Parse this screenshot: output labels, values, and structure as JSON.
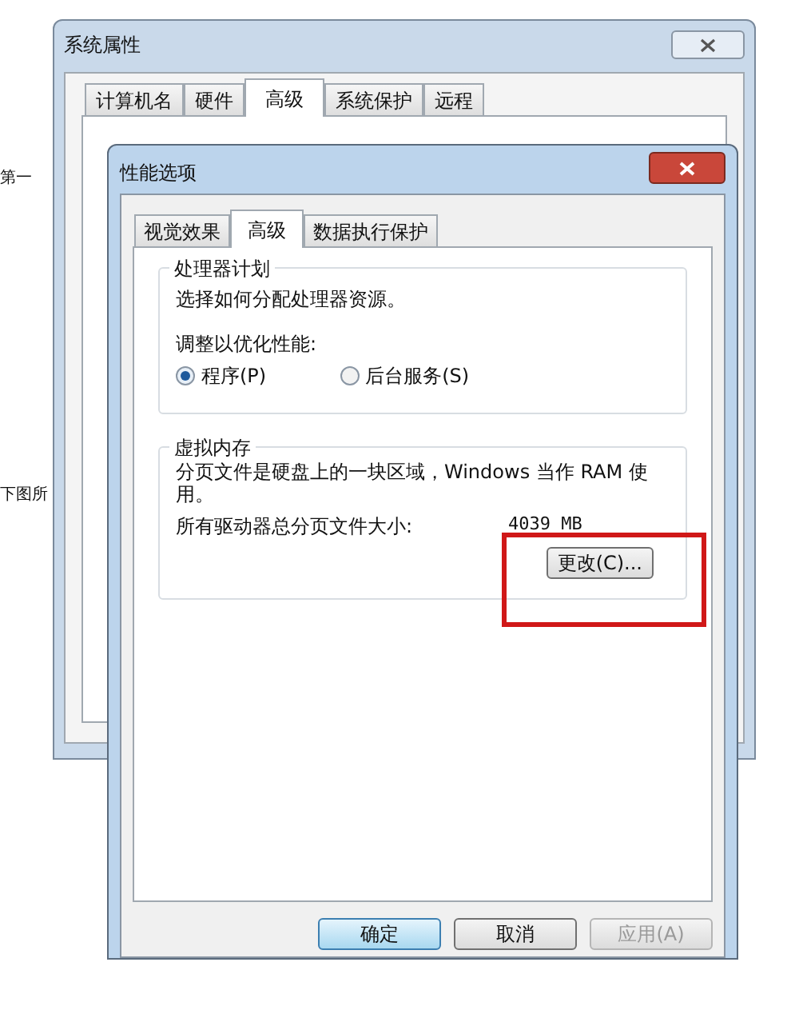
{
  "background_fragments": [
    "第一",
    "下图所"
  ],
  "outer_window": {
    "title": "系统属性",
    "tabs": [
      {
        "label": "计算机名",
        "selected": false
      },
      {
        "label": "硬件",
        "selected": false
      },
      {
        "label": "高级",
        "selected": true
      },
      {
        "label": "系统保护",
        "selected": false
      },
      {
        "label": "远程",
        "selected": false
      }
    ]
  },
  "dialog": {
    "title": "性能选项",
    "tabs": [
      {
        "label": "视觉效果",
        "selected": false
      },
      {
        "label": "高级",
        "selected": true
      },
      {
        "label": "数据执行保护",
        "selected": false
      }
    ],
    "processor_group": {
      "title": "处理器计划",
      "description": "选择如何分配处理器资源。",
      "prompt": "调整以优化性能:",
      "options": [
        {
          "label": "程序(P)",
          "selected": true
        },
        {
          "label": "后台服务(S)",
          "selected": false
        }
      ]
    },
    "memory_group": {
      "title": "虚拟内存",
      "description": "分页文件是硬盘上的一块区域，Windows 当作 RAM 使用。",
      "size_label": "所有驱动器总分页文件大小:",
      "size_value": "4039 MB",
      "change_button": "更改(C)...",
      "highlighted": true
    },
    "buttons": [
      {
        "label": "确定",
        "kind": "default",
        "disabled": false
      },
      {
        "label": "取消",
        "kind": "normal",
        "disabled": false
      },
      {
        "label": "应用(A)",
        "kind": "normal",
        "disabled": true
      }
    ]
  }
}
